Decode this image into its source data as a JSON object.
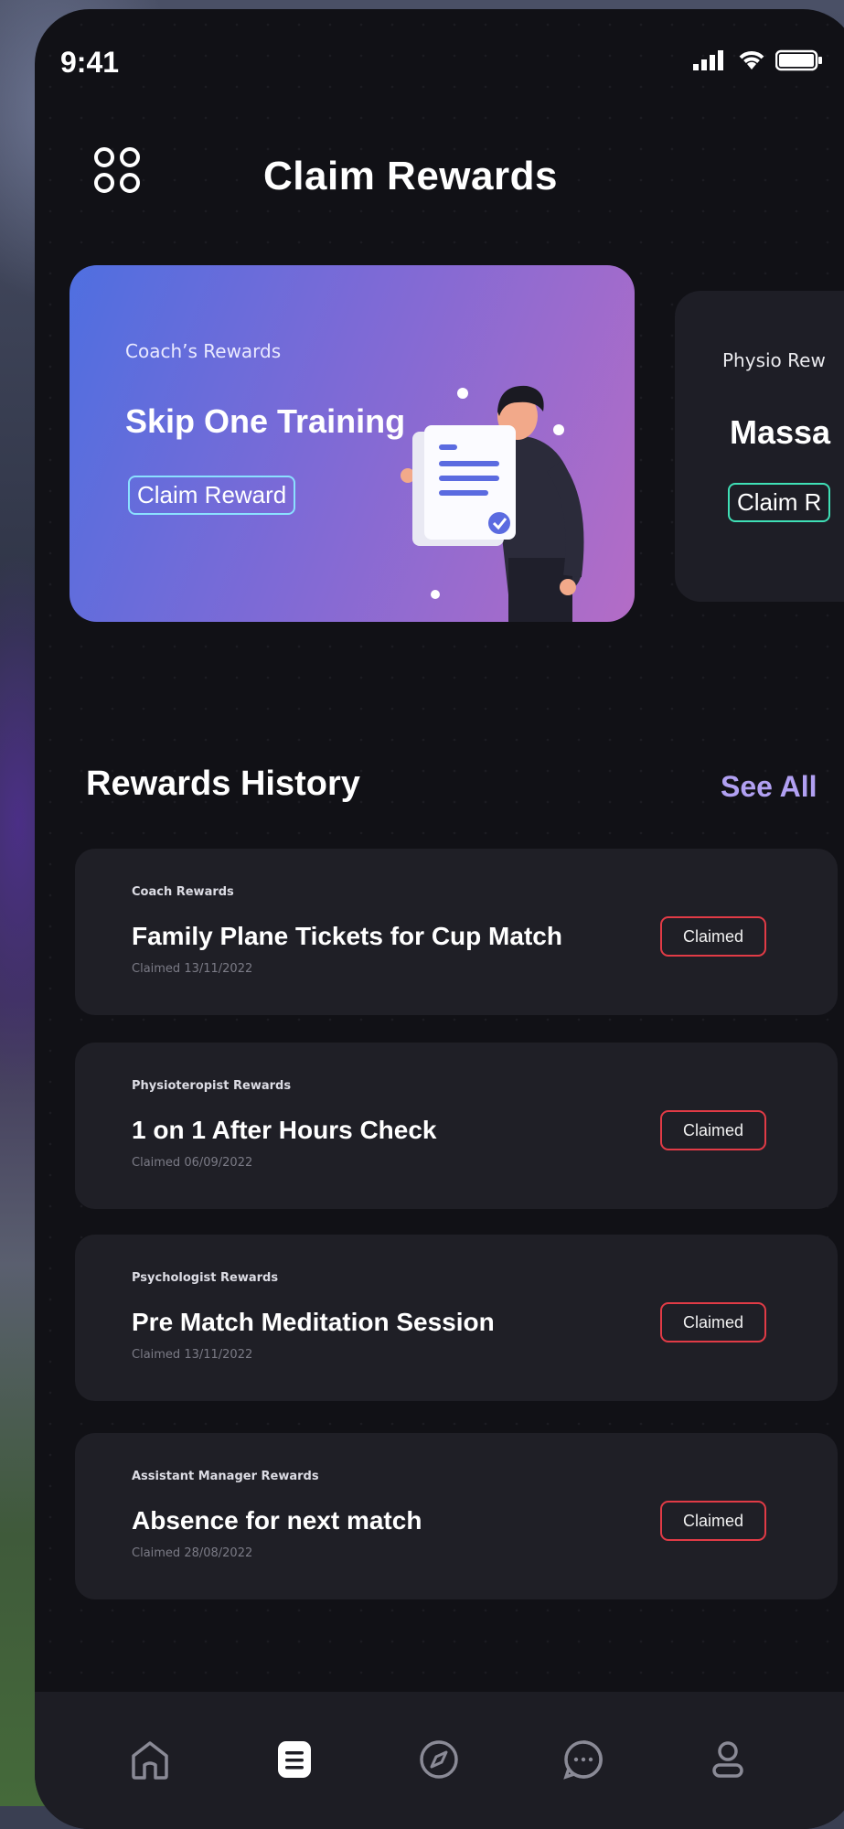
{
  "status_bar": {
    "time": "9:41"
  },
  "header": {
    "title": "Claim Rewards",
    "menu_icon": "grid-icon"
  },
  "reward_cards": [
    {
      "category": "Coach’s Rewards",
      "title": "Skip One Training",
      "button": "Claim Reward"
    },
    {
      "category": "Physio Rew",
      "title": "Massa",
      "button": "Claim R"
    }
  ],
  "history": {
    "title": "Rewards History",
    "see_all": "See All",
    "items": [
      {
        "category": "Coach Rewards",
        "title": "Family Plane Tickets for Cup Match",
        "date": "Claimed 13/11/2022",
        "status": "Claimed"
      },
      {
        "category": "Physioteropist Rewards",
        "title": "1 on 1 After Hours Check",
        "date": "Claimed 06/09/2022",
        "status": "Claimed"
      },
      {
        "category": "Psychologist Rewards",
        "title": "Pre Match Meditation Session",
        "date": "Claimed 13/11/2022",
        "status": "Claimed"
      },
      {
        "category": "Assistant Manager Rewards",
        "title": "Absence for next match",
        "date": "Claimed 28/08/2022",
        "status": "Claimed"
      }
    ]
  },
  "nav": [
    {
      "icon": "home-icon"
    },
    {
      "icon": "rewards-list-icon",
      "active": true
    },
    {
      "icon": "compass-icon"
    },
    {
      "icon": "chat-icon"
    },
    {
      "icon": "profile-icon"
    }
  ],
  "colors": {
    "background": "#111116",
    "card_gradient_start": "#4f6fe0",
    "card_gradient_end": "#b46cc6",
    "claimed_border": "#e13b46",
    "see_all": "#b1a0f2"
  }
}
